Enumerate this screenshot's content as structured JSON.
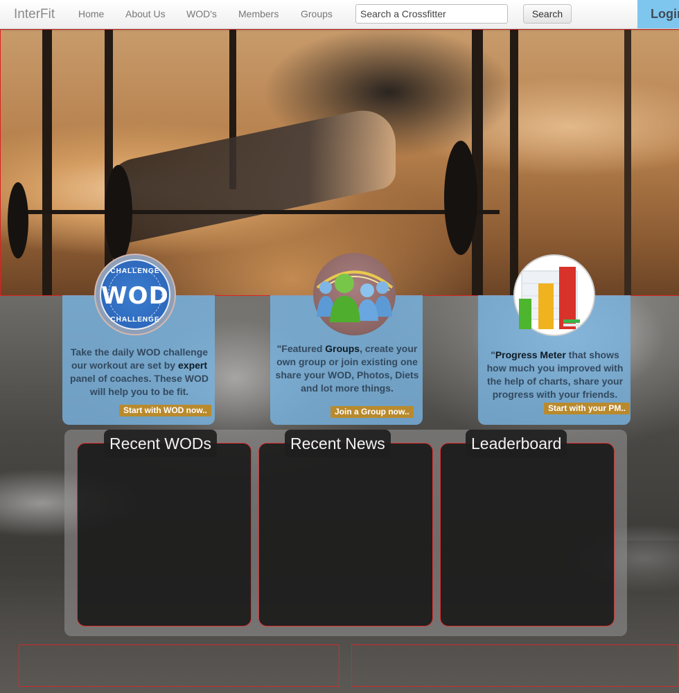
{
  "navbar": {
    "brand": "InterFit",
    "links": [
      "Home",
      "About Us",
      "WOD's",
      "Members",
      "Groups"
    ],
    "search_placeholder": "Search a Crossfitter",
    "search_button": "Search",
    "login_label": "Login"
  },
  "features": [
    {
      "badge_icon": "wod-challenge-badge-icon",
      "badge_top": "CHALLENGE",
      "badge_word": "WOD",
      "badge_bottom": "CHALLENGE",
      "text_lines": [
        "Take the daily WOD challenge",
        "our workout are set by ",
        "expert",
        "panel of coaches. These WOD",
        "will help you to be fit."
      ],
      "cta": "Start with WOD now.."
    },
    {
      "badge_icon": "people-group-icon",
      "text_prefix": "\"Featured ",
      "text_bold": "Groups",
      "text_rest": ", create your own group or join existing one share your WOD, Photos, Diets and lot more things.",
      "cta": "Join a Group now.."
    },
    {
      "badge_icon": "bar-chart-icon",
      "text_prefix": "\"",
      "text_bold": "Progress Meter",
      "text_rest": " that shows how much you improved with the help of charts, share your progress with your friends.",
      "cta": "Start with your PM.."
    }
  ],
  "panels": [
    {
      "title": "Recent WODs"
    },
    {
      "title": "Recent News"
    },
    {
      "title": "Leaderboard"
    }
  ],
  "colors": {
    "card_bg": "#78b2de",
    "cta_bg": "#b98a2d",
    "login_bg": "#7fc6ef",
    "outline_red": "#d22222"
  }
}
